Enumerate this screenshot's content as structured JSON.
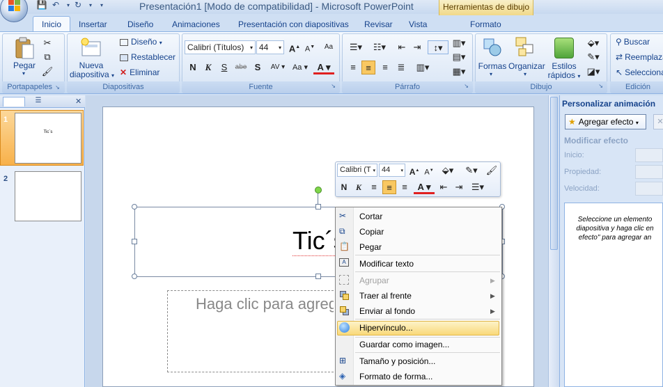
{
  "app": {
    "title": "Presentación1 [Modo de compatibilidad] - Microsoft PowerPoint",
    "contextual_tab_group": "Herramientas de dibujo"
  },
  "tabs": [
    "Inicio",
    "Insertar",
    "Diseño",
    "Animaciones",
    "Presentación con diapositivas",
    "Revisar",
    "Vista",
    "Formato"
  ],
  "active_tab": "Inicio",
  "ribbon": {
    "portapapeles": {
      "label": "Portapapeles",
      "paste": "Pegar"
    },
    "diapositivas": {
      "label": "Diapositivas",
      "new_slide_1": "Nueva",
      "new_slide_2": "diapositiva",
      "layout": "Diseño",
      "reset": "Restablecer",
      "delete": "Eliminar"
    },
    "fuente": {
      "label": "Fuente",
      "font_name": "Calibri (Títulos)",
      "font_size": "44"
    },
    "parrafo": {
      "label": "Párrafo"
    },
    "dibujo": {
      "label": "Dibujo",
      "shapes": "Formas",
      "arrange": "Organizar",
      "styles_1": "Estilos",
      "styles_2": "rápidos"
    },
    "edicion": {
      "label": "Edición",
      "find": "Buscar",
      "replace": "Reemplazar",
      "select": "Seleccionar"
    }
  },
  "slides": [
    {
      "number": "1",
      "title": "Tic´s"
    },
    {
      "number": "2",
      "title": ""
    }
  ],
  "slide": {
    "title_text": "Tic´s",
    "subtitle_placeholder": "Haga clic para agregar subtítulo"
  },
  "mini_toolbar": {
    "font_name": "Calibri (T",
    "font_size": "44"
  },
  "context_menu": [
    {
      "label": "Cortar",
      "icon": "scissors-icon",
      "enabled": true,
      "submenu": false
    },
    {
      "label": "Copiar",
      "icon": "copy-icon",
      "enabled": true,
      "submenu": false
    },
    {
      "label": "Pegar",
      "icon": "paste-icon",
      "enabled": true,
      "submenu": false
    },
    {
      "label": "Modificar texto",
      "icon": "edit-text-icon",
      "enabled": true,
      "submenu": false
    },
    {
      "label": "Agrupar",
      "icon": "group-icon",
      "enabled": false,
      "submenu": true
    },
    {
      "label": "Traer al frente",
      "icon": "bring-front-icon",
      "enabled": true,
      "submenu": true
    },
    {
      "label": "Enviar al fondo",
      "icon": "send-back-icon",
      "enabled": true,
      "submenu": true
    },
    {
      "label": "Hipervínculo...",
      "icon": "hyperlink-icon",
      "enabled": true,
      "submenu": false,
      "highlighted": true
    },
    {
      "label": "Guardar como imagen...",
      "icon": "",
      "enabled": true,
      "submenu": false
    },
    {
      "label": "Tamaño y posición...",
      "icon": "size-position-icon",
      "enabled": true,
      "submenu": false
    },
    {
      "label": "Formato de forma...",
      "icon": "format-shape-icon",
      "enabled": true,
      "submenu": false
    }
  ],
  "task_pane": {
    "title": "Personalizar animación",
    "add_effect": "Agregar efecto",
    "modify_effect": "Modificar efecto",
    "start_label": "Inicio:",
    "property_label": "Propiedad:",
    "speed_label": "Velocidad:",
    "hint_1": "Seleccione un elemento",
    "hint_2": "diapositiva y haga clic en",
    "hint_3": "efecto\" para agregar an"
  },
  "colors": {
    "accent": "#15428b",
    "ribbon_bg": "#dbe7f7",
    "highlight": "#f9d97a",
    "selected_slide": "#f8b14a"
  }
}
